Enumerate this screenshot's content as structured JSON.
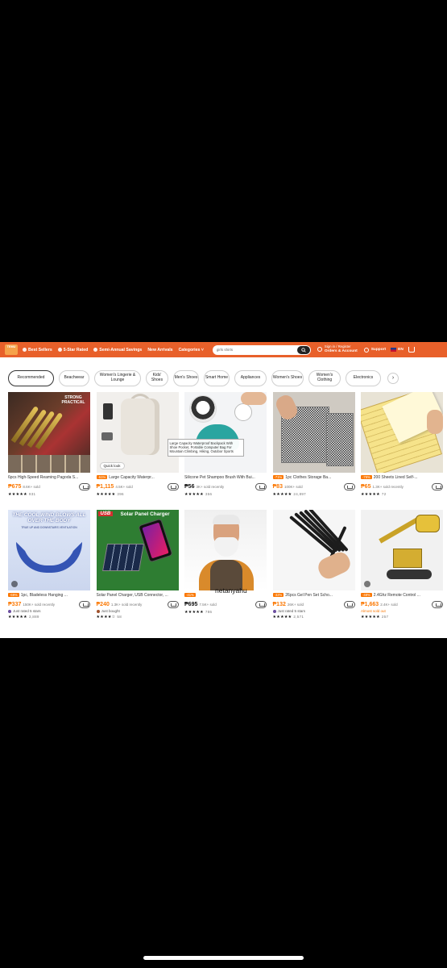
{
  "header": {
    "logo_text": "TEMU",
    "nav": [
      {
        "label": "Best Sellers"
      },
      {
        "label": "5-Star Rated"
      },
      {
        "label": "Semi-Annual Savings"
      },
      {
        "label": "New Arrivals"
      },
      {
        "label": "Categories"
      }
    ],
    "search_value": "girls shirts",
    "account_line1": "Sign in / Register",
    "account_line2": "Orders & Account",
    "support": "Support",
    "language": "EN"
  },
  "categories": [
    {
      "label": "Recommended",
      "active": true
    },
    {
      "label": "Beachwear"
    },
    {
      "label": "Women's Lingerie & Lounge"
    },
    {
      "label": "Kids' Shoes"
    },
    {
      "label": "Men's Shoes"
    },
    {
      "label": "Smart Home"
    },
    {
      "label": "Appliances"
    },
    {
      "label": "Women's Shoes"
    },
    {
      "label": "Women's Clothing"
    },
    {
      "label": "Electronics"
    }
  ],
  "products": [
    {
      "title": "6pcs High-Speed Reaming Pagoda S...",
      "tag": "",
      "price": "675",
      "sold": "8.6K+ sold",
      "note": "",
      "rating_count": "931",
      "image_text": "STRONG PRACTICAL"
    },
    {
      "title": "Large Capacity Waterpr...",
      "tag": "-51%",
      "price": "1,115",
      "sold": "4.5K+ sold",
      "note": "",
      "rating_count": "396",
      "quick_look": "Quick look",
      "tooltip": "Large Capacity Waterproof Backpack With Shoe Pocket, Portable Computer Bag For Mountain Climbing, Hiking, Outdoor Sports"
    },
    {
      "title": "Silicone Pet Shampoo Brush With Bui...",
      "tag": "",
      "price": "56",
      "sold": "3K+ sold recently",
      "note": "",
      "rating_count": "356"
    },
    {
      "title": "1pc Clothes Storage Ba...",
      "tag": "-71%",
      "price": "83",
      "sold": "100K+ sold",
      "note": "",
      "rating_count": "24,897"
    },
    {
      "title": "200 Sheets Lined Self-...",
      "tag": "-76%",
      "price": "65",
      "sold": "1.3K+ sold recently",
      "note": "",
      "rating_count": "72"
    },
    {
      "title": "1pc, Bladeless Hanging ...",
      "tag": "-69%",
      "price": "337",
      "sold": "150K+ sold recently",
      "note": "Just rated 5 stars",
      "rating_count": "3,889",
      "image_text": "THE COOL WIND BLOWS ALL OVER THE BODY",
      "image_subtext": "TRUE UP AND DOWNSTAIRS VENTILATION"
    },
    {
      "title": "Solar Panel Charger, USB Connector, ...",
      "tag": "",
      "price": "240",
      "sold": "1.3K+ sold recently",
      "note": "Just bought",
      "rating_count": "58",
      "image_badge": "USB",
      "image_text": "Solar Panel Charger"
    },
    {
      "title": "",
      "tag": "-41%",
      "price": "695",
      "sold": "7.5K+ sold",
      "note": "",
      "rating_count": "786",
      "overlay_text": "netanyahu"
    },
    {
      "title": "26pcs Gel Pen Set Scho...",
      "tag": "-32%",
      "price": "132",
      "sold": "26K+ sold",
      "note": "Just rated 5 stars",
      "rating_count": "2,571"
    },
    {
      "title": "2.4Ghz Remote Control ...",
      "tag": "-48%",
      "price": "1,663",
      "sold": "2.4K+ sold",
      "note": "Almost sold out",
      "rating_count": "257"
    }
  ],
  "colors": {
    "header_bg": "#e8602a",
    "accent": "#fb7701"
  }
}
